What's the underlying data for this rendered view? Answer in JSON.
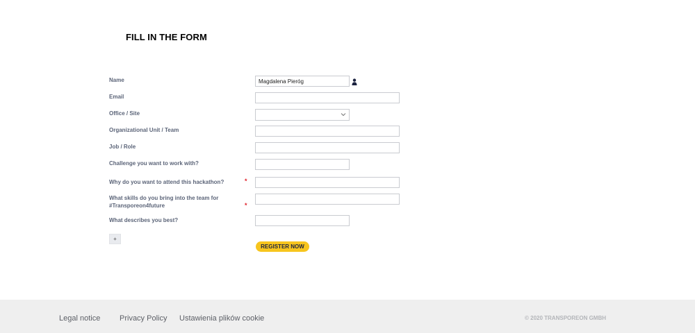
{
  "form": {
    "title": "FILL IN THE FORM",
    "fields": [
      {
        "label": "Name",
        "value": "Magdalena Pieróg"
      },
      {
        "label": "Email",
        "value": ""
      },
      {
        "label": "Office / Site",
        "value": ""
      },
      {
        "label": "Organizational Unit / Team",
        "value": ""
      },
      {
        "label": "Job / Role",
        "value": ""
      },
      {
        "label": "Challenge you want to work with?",
        "value": ""
      },
      {
        "label": "Why do you want to attend this hackathon?",
        "value": "",
        "required": true
      },
      {
        "label_line1": "What skills do you bring into the team for",
        "label_line2": "#Transporeon4future",
        "value": "",
        "required": true
      },
      {
        "label": "What describes you best?",
        "value": ""
      }
    ],
    "required_marker": "*",
    "add_button_label": "+",
    "submit_label": "REGISTER NOW",
    "name_icon": "user-icon",
    "select_icon": "chevron-down-icon"
  },
  "footer": {
    "links": [
      "Legal notice",
      "Privacy Policy",
      "Ustawienia plików cookie"
    ],
    "copyright": "© 2020 TRANSPOREON GMBH"
  },
  "colors": {
    "accent": "#f7c51e",
    "label": "#5b6478",
    "required": "#e0202a",
    "footer_bg": "#efefef"
  }
}
